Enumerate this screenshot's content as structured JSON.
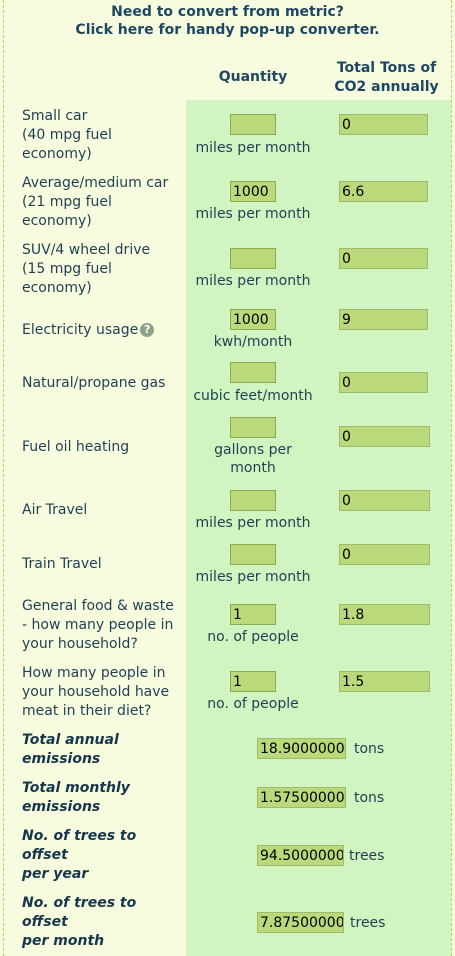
{
  "banner": {
    "line1": "Need to convert from metric?",
    "line2": "Click here for handy pop-up converter."
  },
  "headers": {
    "quantity": "Quantity",
    "total_line1": "Total Tons of",
    "total_line2": "CO2 annually"
  },
  "rows": {
    "small_car": {
      "l1": "Small car",
      "l2": "(40 mpg fuel",
      "l3": "economy)",
      "qty": "",
      "unit": "miles per month",
      "tons": "0"
    },
    "medium_car": {
      "l1": "Average/medium car",
      "l2": "(21 mpg fuel",
      "l3": "economy)",
      "qty": "1000",
      "unit": "miles per month",
      "tons": "6.6"
    },
    "suv": {
      "l1": "SUV/4 wheel drive",
      "l2": "(15 mpg fuel",
      "l3": "economy)",
      "qty": "",
      "unit": "miles per month",
      "tons": "0"
    },
    "electricity": {
      "l1": "Electricity usage",
      "help_icon": "question-circle",
      "qty": "1000",
      "unit": "kwh/month",
      "tons": "9"
    },
    "gas": {
      "l1": "Natural/propane gas",
      "qty": "",
      "unit": "cubic feet/month",
      "tons": "0"
    },
    "fuel_oil": {
      "l1": "Fuel oil heating",
      "qty": "",
      "unit_l1": "gallons per",
      "unit_l2": "month",
      "tons": "0"
    },
    "air": {
      "l1": "Air Travel",
      "qty": "",
      "unit": "miles per month",
      "tons": "0"
    },
    "train": {
      "l1": "Train Travel",
      "qty": "",
      "unit": "miles per month",
      "tons": "0"
    },
    "food": {
      "l1": "General food & waste",
      "l2": "- how many people in",
      "l3": "your household?",
      "qty": "1",
      "unit": "no. of people",
      "tons": "1.8"
    },
    "meat": {
      "l1": "How many people in",
      "l2": "your household have",
      "l3": "meat in their diet?",
      "qty": "1",
      "unit": "no. of people",
      "tons": "1.5"
    }
  },
  "totals": {
    "annual": {
      "l1": "Total annual",
      "l2": "emissions",
      "value": "18.9000000",
      "suffix": "tons"
    },
    "monthly": {
      "l1": "Total monthly",
      "l2": "emissions",
      "value": "1.57500000",
      "suffix": "tons"
    },
    "trees_year": {
      "l1": "No. of trees to",
      "l2": "offset",
      "l3": "per year",
      "value": "94.5000000",
      "suffix": "trees"
    },
    "trees_month": {
      "l1": "No. of trees to",
      "l2": "offset",
      "l3": "per month",
      "value": "7.87500000",
      "suffix": "trees"
    }
  }
}
